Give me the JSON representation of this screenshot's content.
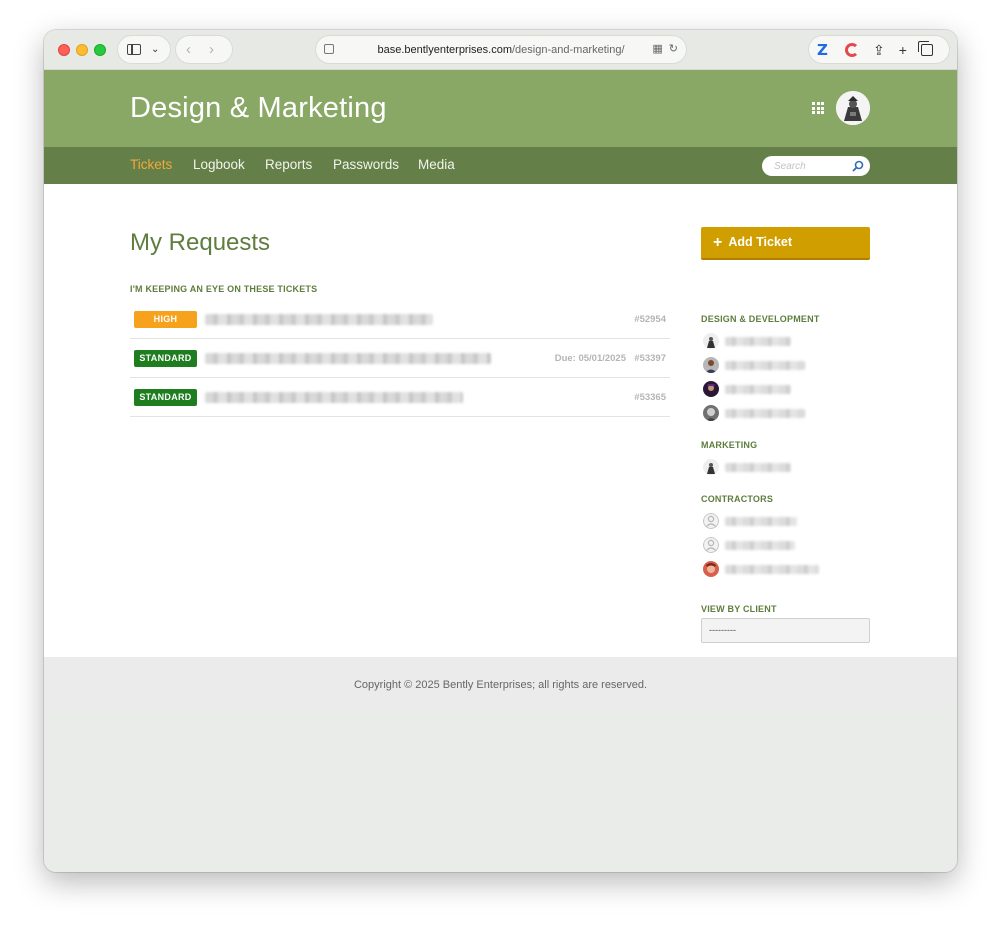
{
  "browser": {
    "url_domain": "base.bentlyenterprises.com",
    "url_path": "/design-and-marketing/"
  },
  "header": {
    "title": "Design & Marketing"
  },
  "nav": {
    "items": [
      {
        "label": "Tickets",
        "active": true
      },
      {
        "label": "Logbook",
        "active": false
      },
      {
        "label": "Reports",
        "active": false
      },
      {
        "label": "Passwords",
        "active": false
      },
      {
        "label": "Media",
        "active": false
      }
    ],
    "search_placeholder": "Search"
  },
  "main": {
    "title": "My Requests",
    "section_label": "I'M KEEPING AN EYE ON THESE TICKETS",
    "tickets": [
      {
        "priority": "HIGH",
        "due": "",
        "number": "#52954"
      },
      {
        "priority": "STANDARD",
        "due": "Due: 05/01/2025",
        "number": "#53397"
      },
      {
        "priority": "STANDARD",
        "due": "",
        "number": "#53365"
      }
    ]
  },
  "sidebar": {
    "add_ticket_label": "Add Ticket",
    "groups": [
      {
        "heading": "DESIGN & DEVELOPMENT"
      },
      {
        "heading": "MARKETING"
      },
      {
        "heading": "CONTRACTORS"
      }
    ],
    "view_by_client_label": "VIEW BY CLIENT",
    "client_select_value": "---------"
  },
  "footer": {
    "copyright": "Copyright © 2025 Bently Enterprises; all rights are reserved."
  },
  "colors": {
    "header_green": "#89a866",
    "nav_green": "#647f47",
    "accent_orange": "#f2a93b",
    "add_ticket_gold": "#d19e00",
    "badge_high": "#f6a21c",
    "badge_standard": "#1e7d1e"
  }
}
